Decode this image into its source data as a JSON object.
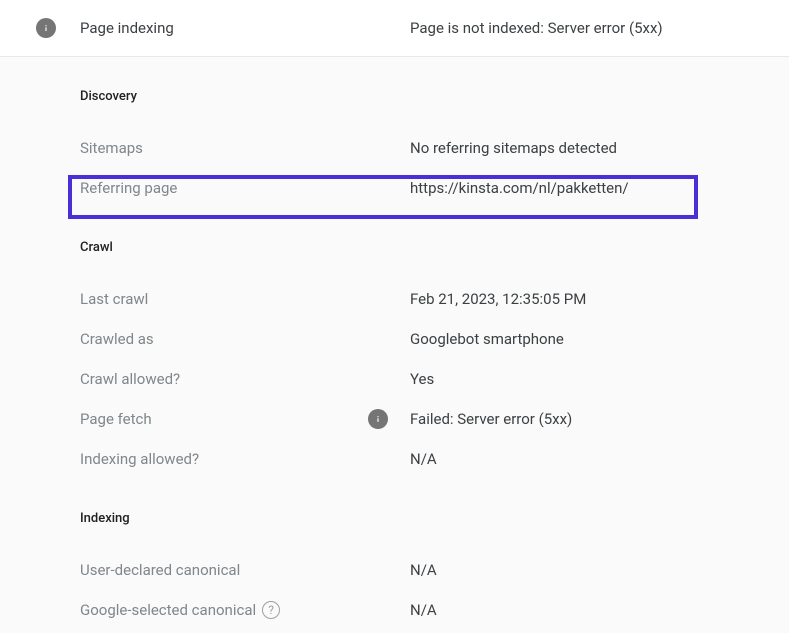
{
  "header": {
    "title": "Page indexing",
    "status": "Page is not indexed: Server error (5xx)"
  },
  "sections": {
    "discovery": {
      "heading": "Discovery",
      "sitemaps_label": "Sitemaps",
      "sitemaps_value": "No referring sitemaps detected",
      "referring_label": "Referring page",
      "referring_value": "https://kinsta.com/nl/pakketten/"
    },
    "crawl": {
      "heading": "Crawl",
      "last_crawl_label": "Last crawl",
      "last_crawl_value": "Feb 21, 2023, 12:35:05 PM",
      "crawled_as_label": "Crawled as",
      "crawled_as_value": "Googlebot smartphone",
      "crawl_allowed_label": "Crawl allowed?",
      "crawl_allowed_value": "Yes",
      "page_fetch_label": "Page fetch",
      "page_fetch_value": "Failed: Server error (5xx)",
      "indexing_allowed_label": "Indexing allowed?",
      "indexing_allowed_value": "N/A"
    },
    "indexing": {
      "heading": "Indexing",
      "user_canonical_label": "User-declared canonical",
      "user_canonical_value": "N/A",
      "google_canonical_label": "Google-selected canonical",
      "google_canonical_value": "N/A"
    }
  },
  "highlight": {
    "color": "#4b2fd6"
  }
}
